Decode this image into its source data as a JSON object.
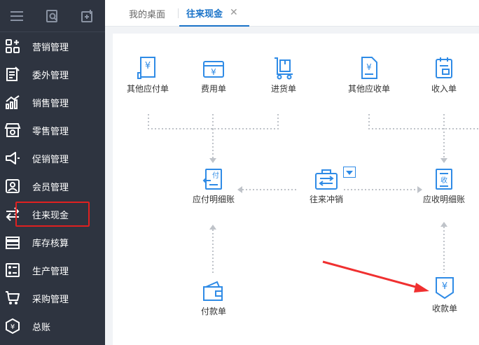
{
  "sidebar": {
    "items": [
      {
        "label": "营销管理",
        "icon": "grid-apps-icon"
      },
      {
        "label": "委外管理",
        "icon": "document-edit-icon"
      },
      {
        "label": "销售管理",
        "icon": "bar-trend-icon"
      },
      {
        "label": "零售管理",
        "icon": "shop-icon"
      },
      {
        "label": "促销管理",
        "icon": "megaphone-icon"
      },
      {
        "label": "会员管理",
        "icon": "member-card-icon"
      },
      {
        "label": "往来现金",
        "icon": "transfer-arrows-icon"
      },
      {
        "label": "库存核算",
        "icon": "warehouse-icon"
      },
      {
        "label": "生产管理",
        "icon": "production-icon"
      },
      {
        "label": "采购管理",
        "icon": "cart-icon"
      },
      {
        "label": "总账",
        "icon": "ledger-icon"
      }
    ]
  },
  "tabs": {
    "home": "我的桌面",
    "active": "往来现金",
    "close": "✕"
  },
  "flow": {
    "other_payable": "其他应付单",
    "expense": "费用单",
    "purchase_in": "进货单",
    "other_receivable": "其他应收单",
    "income": "收入单",
    "payable_detail": "应付明细账",
    "offset": "往来冲销",
    "receivable_detail": "应收明细账",
    "payment": "付款单",
    "receipt": "收款单",
    "icon_texts": {
      "yen": "¥",
      "pay": "付",
      "collect": "收"
    }
  },
  "colors": {
    "accent": "#1a73c8",
    "icon_blue": "#2f8be6",
    "sidebar_bg": "#2e3440",
    "highlight_red": "#e02020",
    "arrow_red": "#f03030"
  }
}
